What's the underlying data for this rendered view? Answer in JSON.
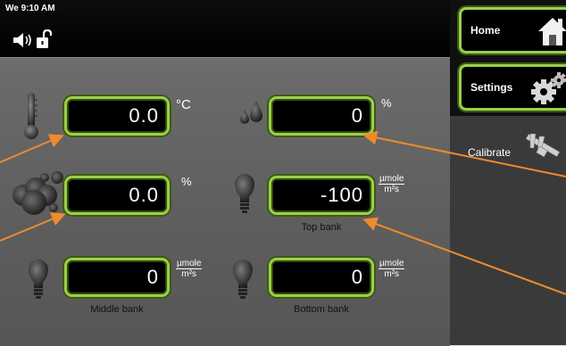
{
  "status_bar": {
    "clock": "We 9:10 AM",
    "icons": [
      "speaker-icon",
      "unlocked-padlock-icon"
    ]
  },
  "readings": {
    "temperature": {
      "value": "0.0",
      "unit": "°C",
      "icon": "thermometer-icon"
    },
    "humidity": {
      "value": "0",
      "unit": "%",
      "icon": "water-drops-icon"
    },
    "co2": {
      "value": "0.0",
      "unit": "%",
      "icon": "co2-cloud-icon"
    },
    "top_bank": {
      "value": "-100",
      "unit_numerator": "µmole",
      "unit_denominator": "m²s",
      "caption": "Top bank",
      "icon": "light-bulb-icon"
    },
    "middle_bank": {
      "value": "0",
      "unit_numerator": "µmole",
      "unit_denominator": "m²s",
      "caption": "Middle bank",
      "icon": "light-bulb-icon"
    },
    "bottom_bank": {
      "value": "0",
      "unit_numerator": "µmole",
      "unit_denominator": "m²s",
      "caption": "Bottom bank",
      "icon": "light-bulb-icon"
    }
  },
  "nav": {
    "home_label": "Home",
    "settings_label": "Settings",
    "calibrate_label": "Calibrate",
    "icons": [
      "home-icon",
      "gears-icon",
      "caliper-icon"
    ]
  },
  "colors": {
    "field_border": "#9ccf4a",
    "callout_arrow": "#f08a2c",
    "panel_background": "#5e5e5e"
  }
}
